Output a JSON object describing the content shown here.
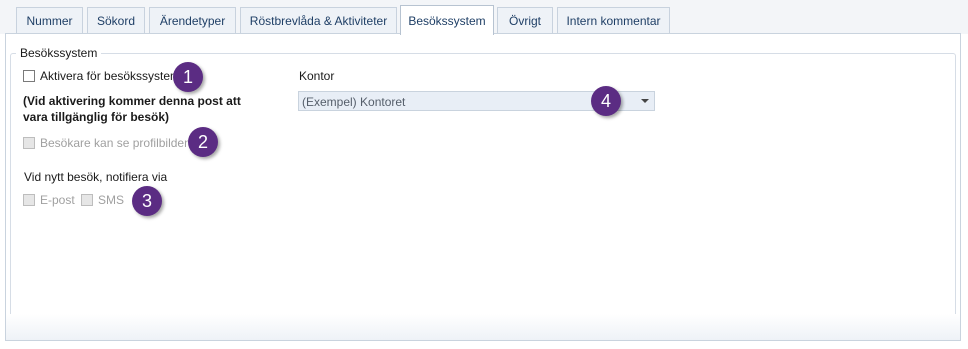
{
  "tabs": [
    {
      "label": "Nummer"
    },
    {
      "label": "Sökord"
    },
    {
      "label": "Ärendetyper"
    },
    {
      "label": "Röstbrevlåda & Aktiviteter"
    },
    {
      "label": "Besökssystem",
      "active": true
    },
    {
      "label": "Övrigt"
    },
    {
      "label": "Intern kommentar"
    }
  ],
  "group": {
    "legend": "Besökssystem",
    "activate_label": "Aktivera för besökssystem",
    "activate_checked": false,
    "note": "(Vid aktivering kommer denna post att vara tillgänglig för besök)",
    "profile_label": "Besökare kan se profilbilden",
    "notify_title": "Vid nytt besök, notifiera via",
    "email_label": "E-post",
    "sms_label": "SMS"
  },
  "office": {
    "label": "Kontor",
    "selected": "(Exempel) Kontoret"
  },
  "callouts": [
    "1",
    "2",
    "3",
    "4"
  ],
  "colors": {
    "callout": "#5b2c83",
    "tab_text": "#1f3f66",
    "dropdown_bg": "#e8eef6"
  }
}
